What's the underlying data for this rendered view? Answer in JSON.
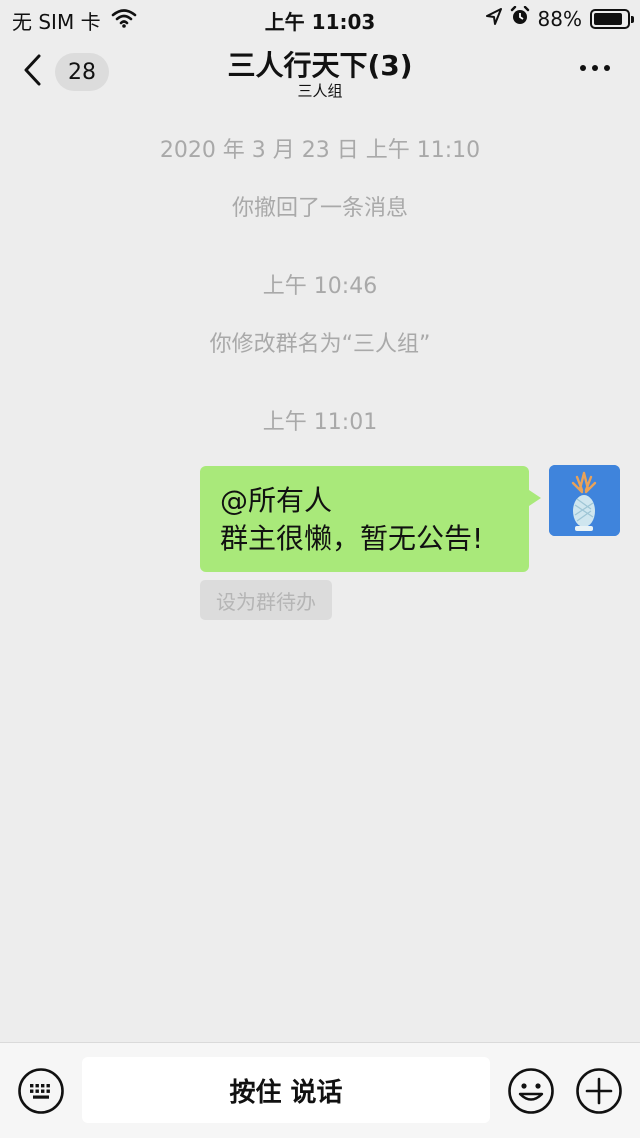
{
  "status_bar": {
    "carrier": "无 SIM 卡",
    "time": "上午 11:03",
    "battery_percent": "88%",
    "battery_level": 0.88,
    "icons": [
      "wifi-icon",
      "location-icon",
      "alarm-icon",
      "battery-icon"
    ]
  },
  "nav": {
    "back_icon": "chevron-left-icon",
    "unread_count": "28",
    "title": "三人行天下(3)",
    "subtitle": "三人组",
    "more_icon": "more-dots-icon"
  },
  "messages": {
    "timestamp1": "2020 年 3 月 23 日 上午 11:10",
    "system1": "你撤回了一条消息",
    "timestamp2": "上午 10:46",
    "system2": "你修改群名为“三人组”",
    "timestamp3": "上午 11:01",
    "bubble_line1": "@所有人",
    "bubble_line2": "群主很懒，暂无公告!",
    "todo_label": "设为群待办"
  },
  "input_bar": {
    "keyboard_icon": "keyboard-icon",
    "voice_label": "按住 说话",
    "emoji_icon": "emoji-icon",
    "plus_icon": "plus-icon"
  },
  "colors": {
    "background": "#ededed",
    "bubble_green": "#a9e97a",
    "system_text": "#a9a9a9"
  }
}
